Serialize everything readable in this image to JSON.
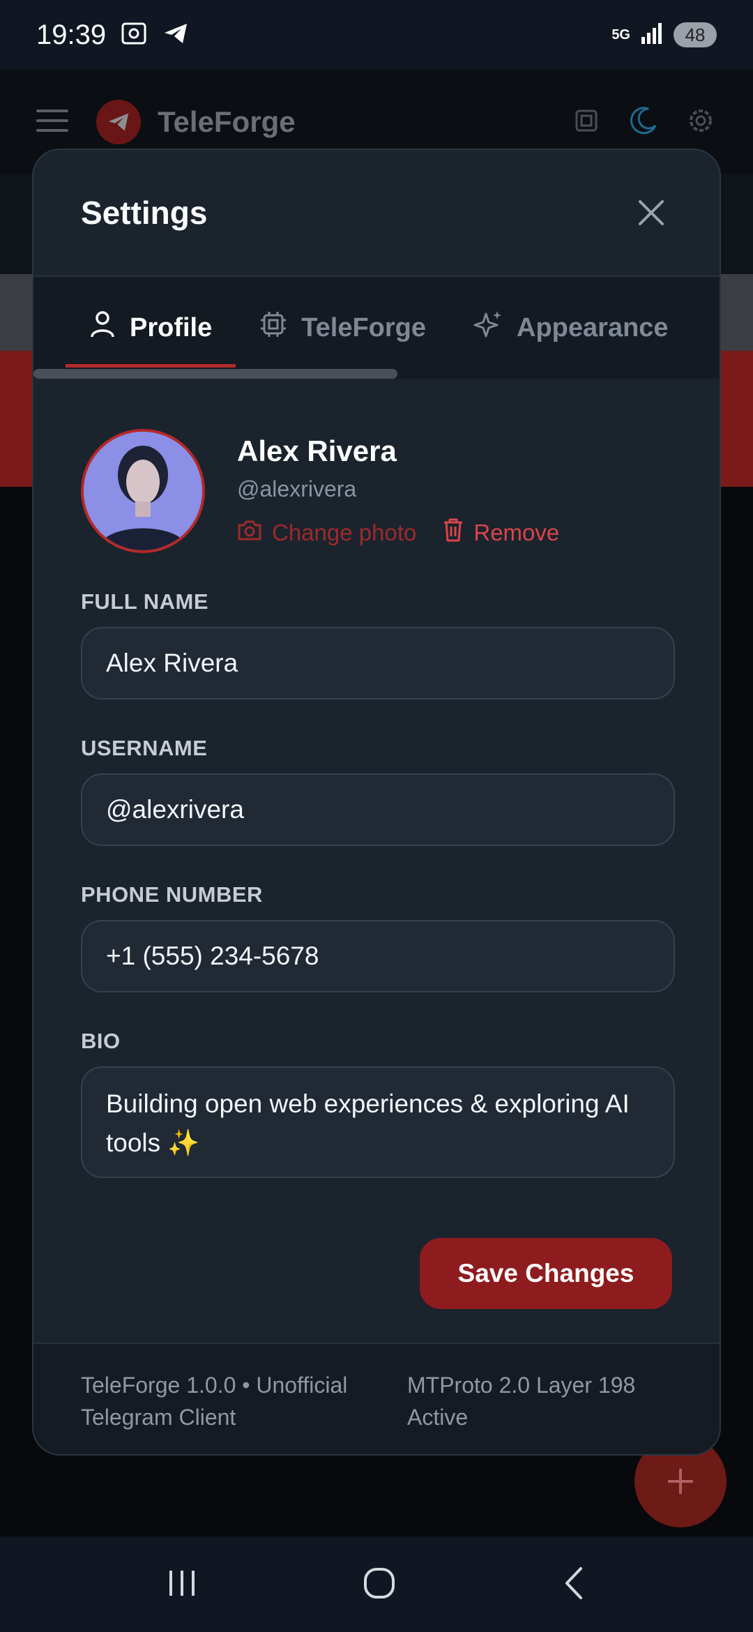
{
  "status_bar": {
    "time": "19:39",
    "battery": "48",
    "network": "5G"
  },
  "app": {
    "title": "TeleForge",
    "icons": [
      "menu-icon",
      "telegram-logo",
      "cpu-icon",
      "moon-icon",
      "gear-icon"
    ]
  },
  "modal": {
    "title": "Settings",
    "tabs": [
      {
        "label": "Profile",
        "icon": "user-icon",
        "active": true
      },
      {
        "label": "TeleForge",
        "icon": "cpu-icon",
        "active": false
      },
      {
        "label": "Appearance",
        "icon": "sparkles-icon",
        "active": false
      }
    ],
    "profile": {
      "name": "Alex Rivera",
      "handle": "@alexrivera",
      "change_photo": "Change photo",
      "remove": "Remove"
    },
    "fields": {
      "full_name_label": "FULL NAME",
      "full_name_value": "Alex Rivera",
      "username_label": "USERNAME",
      "username_value": "@alexrivera",
      "phone_label": "PHONE NUMBER",
      "phone_value": "+1 (555) 234-5678",
      "bio_label": "BIO",
      "bio_value": "Building open web experiences & exploring AI tools ✨"
    },
    "save_label": "Save Changes",
    "footer": {
      "left": "TeleForge 1.0.0 • Unofficial Telegram Client",
      "right": "MTProto 2.0 Layer 198 Active"
    }
  },
  "colors": {
    "accent": "#b42929",
    "save_button": "#8e1c1f",
    "remove_text": "#d9454a",
    "modal_bg": "#1b232d"
  }
}
